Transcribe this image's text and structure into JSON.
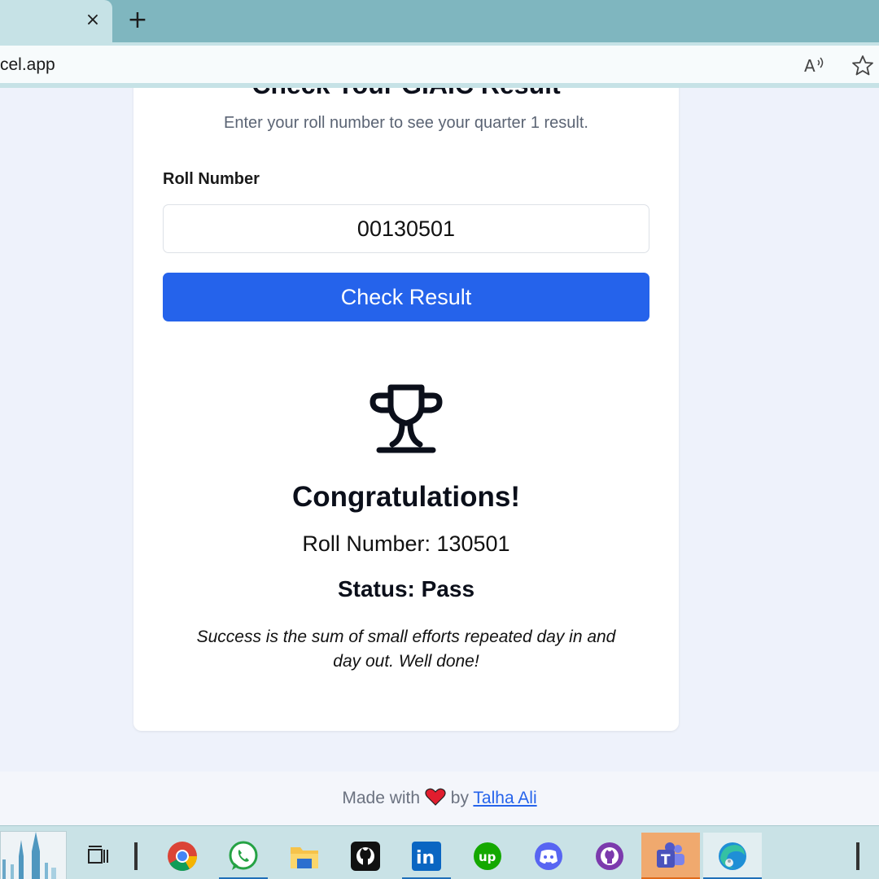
{
  "browser": {
    "tab_close": "×",
    "new_tab": "+",
    "url": "cel.app",
    "read_aloud": "Aᵃ⁾"
  },
  "card": {
    "title": "Check Your GIAIC Result",
    "subtitle": "Enter your roll number to see your quarter 1 result.",
    "roll_label": "Roll Number",
    "roll_value": "00130501",
    "check_button": "Check Result"
  },
  "result": {
    "heading": "Congratulations!",
    "roll_line": "Roll Number: 130501",
    "status_line": "Status: Pass",
    "quote": "Success is the sum of small efforts repeated day in and day out. Well done!"
  },
  "footer": {
    "made_with": "Made with",
    "by": "by",
    "author": "Talha Ali"
  },
  "taskbar": {
    "apps": [
      "task-view",
      "chrome",
      "whatsapp",
      "file-explorer",
      "github",
      "linkedin",
      "upwork",
      "discord",
      "github-desktop",
      "teams",
      "edge"
    ]
  },
  "colors": {
    "primary": "#2563eb",
    "tab_strip": "#7fb6bf",
    "page_bg": "#eef2fb"
  }
}
